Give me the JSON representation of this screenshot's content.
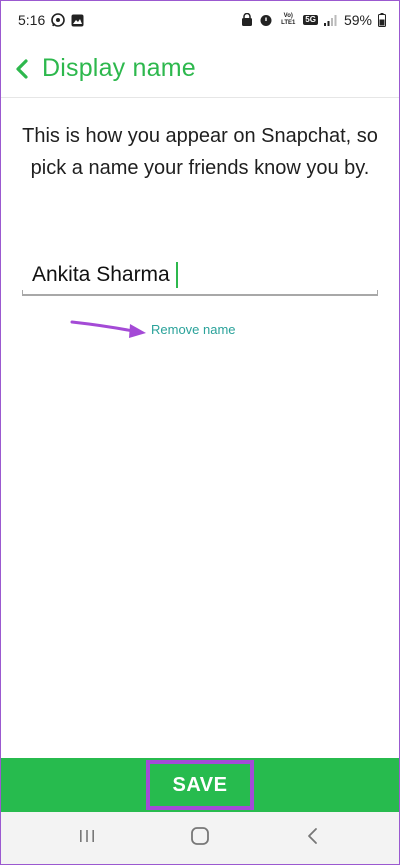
{
  "status_bar": {
    "time": "5:16",
    "battery": "59%",
    "network_label_top": "Vo) LTE1",
    "network_gen": "5G"
  },
  "header": {
    "title": "Display name"
  },
  "content": {
    "description": "This is how you appear on Snapchat, so pick a name your friends know you by.",
    "name_value": "Ankita Sharma",
    "remove_label": "Remove name"
  },
  "footer": {
    "save_label": "SAVE"
  },
  "colors": {
    "accent_green": "#2db84d",
    "save_bar": "#27bb4e",
    "remove_link": "#2aa29a",
    "annotation_purple": "#a44ad6"
  }
}
